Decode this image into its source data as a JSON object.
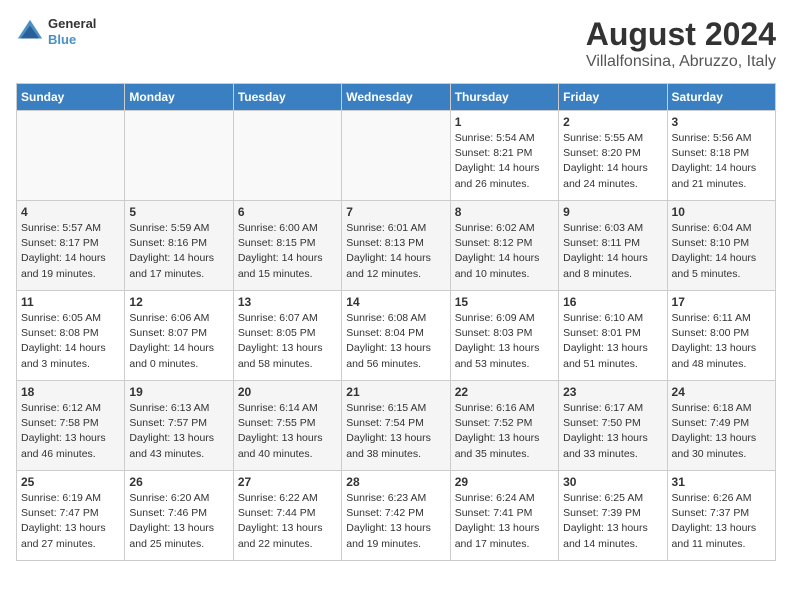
{
  "logo": {
    "line1": "General",
    "line2": "Blue"
  },
  "title": "August 2024",
  "subtitle": "Villalfonsina, Abruzzo, Italy",
  "days_of_week": [
    "Sunday",
    "Monday",
    "Tuesday",
    "Wednesday",
    "Thursday",
    "Friday",
    "Saturday"
  ],
  "weeks": [
    [
      {
        "day": "",
        "info": ""
      },
      {
        "day": "",
        "info": ""
      },
      {
        "day": "",
        "info": ""
      },
      {
        "day": "",
        "info": ""
      },
      {
        "day": "1",
        "info": "Sunrise: 5:54 AM\nSunset: 8:21 PM\nDaylight: 14 hours\nand 26 minutes."
      },
      {
        "day": "2",
        "info": "Sunrise: 5:55 AM\nSunset: 8:20 PM\nDaylight: 14 hours\nand 24 minutes."
      },
      {
        "day": "3",
        "info": "Sunrise: 5:56 AM\nSunset: 8:18 PM\nDaylight: 14 hours\nand 21 minutes."
      }
    ],
    [
      {
        "day": "4",
        "info": "Sunrise: 5:57 AM\nSunset: 8:17 PM\nDaylight: 14 hours\nand 19 minutes."
      },
      {
        "day": "5",
        "info": "Sunrise: 5:59 AM\nSunset: 8:16 PM\nDaylight: 14 hours\nand 17 minutes."
      },
      {
        "day": "6",
        "info": "Sunrise: 6:00 AM\nSunset: 8:15 PM\nDaylight: 14 hours\nand 15 minutes."
      },
      {
        "day": "7",
        "info": "Sunrise: 6:01 AM\nSunset: 8:13 PM\nDaylight: 14 hours\nand 12 minutes."
      },
      {
        "day": "8",
        "info": "Sunrise: 6:02 AM\nSunset: 8:12 PM\nDaylight: 14 hours\nand 10 minutes."
      },
      {
        "day": "9",
        "info": "Sunrise: 6:03 AM\nSunset: 8:11 PM\nDaylight: 14 hours\nand 8 minutes."
      },
      {
        "day": "10",
        "info": "Sunrise: 6:04 AM\nSunset: 8:10 PM\nDaylight: 14 hours\nand 5 minutes."
      }
    ],
    [
      {
        "day": "11",
        "info": "Sunrise: 6:05 AM\nSunset: 8:08 PM\nDaylight: 14 hours\nand 3 minutes."
      },
      {
        "day": "12",
        "info": "Sunrise: 6:06 AM\nSunset: 8:07 PM\nDaylight: 14 hours\nand 0 minutes."
      },
      {
        "day": "13",
        "info": "Sunrise: 6:07 AM\nSunset: 8:05 PM\nDaylight: 13 hours\nand 58 minutes."
      },
      {
        "day": "14",
        "info": "Sunrise: 6:08 AM\nSunset: 8:04 PM\nDaylight: 13 hours\nand 56 minutes."
      },
      {
        "day": "15",
        "info": "Sunrise: 6:09 AM\nSunset: 8:03 PM\nDaylight: 13 hours\nand 53 minutes."
      },
      {
        "day": "16",
        "info": "Sunrise: 6:10 AM\nSunset: 8:01 PM\nDaylight: 13 hours\nand 51 minutes."
      },
      {
        "day": "17",
        "info": "Sunrise: 6:11 AM\nSunset: 8:00 PM\nDaylight: 13 hours\nand 48 minutes."
      }
    ],
    [
      {
        "day": "18",
        "info": "Sunrise: 6:12 AM\nSunset: 7:58 PM\nDaylight: 13 hours\nand 46 minutes."
      },
      {
        "day": "19",
        "info": "Sunrise: 6:13 AM\nSunset: 7:57 PM\nDaylight: 13 hours\nand 43 minutes."
      },
      {
        "day": "20",
        "info": "Sunrise: 6:14 AM\nSunset: 7:55 PM\nDaylight: 13 hours\nand 40 minutes."
      },
      {
        "day": "21",
        "info": "Sunrise: 6:15 AM\nSunset: 7:54 PM\nDaylight: 13 hours\nand 38 minutes."
      },
      {
        "day": "22",
        "info": "Sunrise: 6:16 AM\nSunset: 7:52 PM\nDaylight: 13 hours\nand 35 minutes."
      },
      {
        "day": "23",
        "info": "Sunrise: 6:17 AM\nSunset: 7:50 PM\nDaylight: 13 hours\nand 33 minutes."
      },
      {
        "day": "24",
        "info": "Sunrise: 6:18 AM\nSunset: 7:49 PM\nDaylight: 13 hours\nand 30 minutes."
      }
    ],
    [
      {
        "day": "25",
        "info": "Sunrise: 6:19 AM\nSunset: 7:47 PM\nDaylight: 13 hours\nand 27 minutes."
      },
      {
        "day": "26",
        "info": "Sunrise: 6:20 AM\nSunset: 7:46 PM\nDaylight: 13 hours\nand 25 minutes."
      },
      {
        "day": "27",
        "info": "Sunrise: 6:22 AM\nSunset: 7:44 PM\nDaylight: 13 hours\nand 22 minutes."
      },
      {
        "day": "28",
        "info": "Sunrise: 6:23 AM\nSunset: 7:42 PM\nDaylight: 13 hours\nand 19 minutes."
      },
      {
        "day": "29",
        "info": "Sunrise: 6:24 AM\nSunset: 7:41 PM\nDaylight: 13 hours\nand 17 minutes."
      },
      {
        "day": "30",
        "info": "Sunrise: 6:25 AM\nSunset: 7:39 PM\nDaylight: 13 hours\nand 14 minutes."
      },
      {
        "day": "31",
        "info": "Sunrise: 6:26 AM\nSunset: 7:37 PM\nDaylight: 13 hours\nand 11 minutes."
      }
    ]
  ]
}
